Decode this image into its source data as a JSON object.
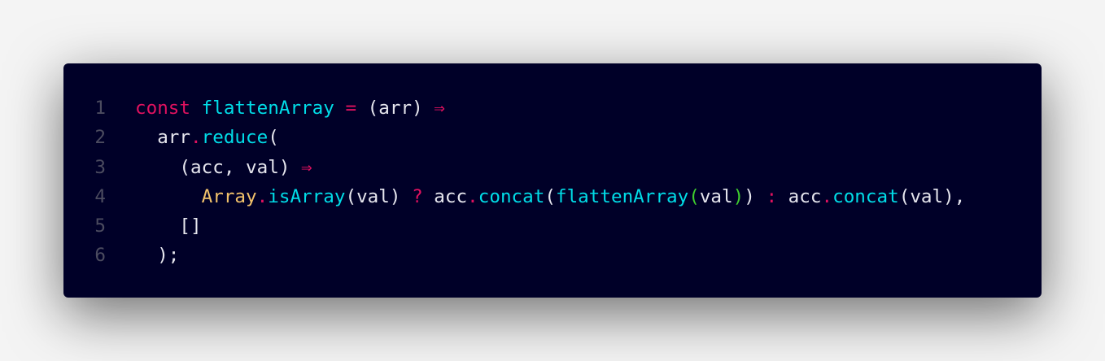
{
  "colors": {
    "background": "#000028",
    "keyword": "#e0115f",
    "function": "#00dde8",
    "text": "#e6e6ee",
    "class": "#f2c26b",
    "bracket": "#3fcf2e",
    "line_number": "#4b4b5f"
  },
  "lines": [
    {
      "number": "1",
      "tokens": [
        {
          "t": "const",
          "c": "keyword"
        },
        {
          "t": " ",
          "c": "text"
        },
        {
          "t": "flattenArray",
          "c": "function"
        },
        {
          "t": " ",
          "c": "text"
        },
        {
          "t": "=",
          "c": "keyword"
        },
        {
          "t": " (arr) ",
          "c": "text"
        },
        {
          "t": "⇒",
          "c": "keyword"
        }
      ]
    },
    {
      "number": "2",
      "tokens": [
        {
          "t": "  arr",
          "c": "text"
        },
        {
          "t": ".",
          "c": "keyword"
        },
        {
          "t": "reduce",
          "c": "function"
        },
        {
          "t": "(",
          "c": "text"
        }
      ]
    },
    {
      "number": "3",
      "tokens": [
        {
          "t": "    (acc, val) ",
          "c": "text"
        },
        {
          "t": "⇒",
          "c": "keyword"
        }
      ]
    },
    {
      "number": "4",
      "tokens": [
        {
          "t": "      ",
          "c": "text"
        },
        {
          "t": "Array",
          "c": "class"
        },
        {
          "t": ".",
          "c": "keyword"
        },
        {
          "t": "isArray",
          "c": "function"
        },
        {
          "t": "(val) ",
          "c": "text"
        },
        {
          "t": "?",
          "c": "keyword"
        },
        {
          "t": " acc",
          "c": "text"
        },
        {
          "t": ".",
          "c": "keyword"
        },
        {
          "t": "concat",
          "c": "function"
        },
        {
          "t": "(",
          "c": "text"
        },
        {
          "t": "flattenArray",
          "c": "function"
        },
        {
          "t": "(",
          "c": "bracket"
        },
        {
          "t": "val",
          "c": "text"
        },
        {
          "t": ")",
          "c": "bracket"
        },
        {
          "t": ") ",
          "c": "text"
        },
        {
          "t": ":",
          "c": "keyword"
        },
        {
          "t": " acc",
          "c": "text"
        },
        {
          "t": ".",
          "c": "keyword"
        },
        {
          "t": "concat",
          "c": "function"
        },
        {
          "t": "(val),",
          "c": "text"
        }
      ]
    },
    {
      "number": "5",
      "tokens": [
        {
          "t": "    []",
          "c": "text"
        }
      ]
    },
    {
      "number": "6",
      "tokens": [
        {
          "t": "  );",
          "c": "text"
        }
      ]
    }
  ]
}
